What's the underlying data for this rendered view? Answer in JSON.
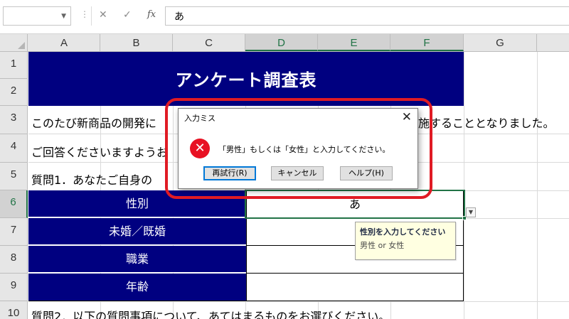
{
  "formula_bar": {
    "name_box": "",
    "separator_glyph": "⋮",
    "cancel_glyph": "✕",
    "enter_glyph": "✓",
    "fx_glyph": "fx",
    "content": "あ"
  },
  "columns": [
    "A",
    "B",
    "C",
    "D",
    "E",
    "F",
    "G"
  ],
  "rows": [
    "1",
    "2",
    "3",
    "4",
    "5",
    "6",
    "7",
    "8",
    "9",
    "10"
  ],
  "sheet": {
    "title": "アンケート調査表",
    "line3": "このたび新商品の開発に",
    "line3_tail": "施することとなりました。",
    "line4": "ご回答くださいますようお",
    "line5": "質問1．あなたご自身の",
    "fields": [
      "性別",
      "未婚／既婚",
      "職業",
      "年齢"
    ],
    "answer": "あ",
    "q2": "質問2．以下の質問事項について、あてはまるものをお選びください。"
  },
  "input_tip": {
    "title": "性別を入力してください",
    "text": "男性 or 女性"
  },
  "dialog": {
    "title": "入力ミス",
    "close_glyph": "✕",
    "error_glyph": "✕",
    "message": "「男性」もしくは「女性」と入力してください。",
    "buttons": [
      "再試行(R)",
      "キャンセル",
      "ヘルプ(H)"
    ]
  },
  "colors": {
    "header_navy": "#000080",
    "excel_green": "#217346",
    "tooltip_bg": "#ffffe1",
    "error_red": "#e81123",
    "annotation_red": "#e01b24"
  }
}
